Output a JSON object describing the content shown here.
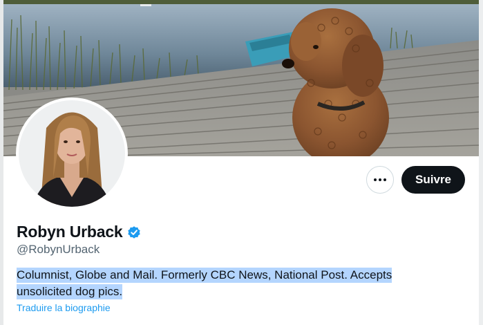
{
  "profile": {
    "display_name": "Robyn Urback",
    "handle": "@RobynUrback",
    "verified": true,
    "bio_line1": "Columnist, Globe and Mail. Formerly CBC News, National Post. Accepts",
    "bio_line2": "unsolicited dog pics.",
    "translate_link": "Traduire la biographie"
  },
  "actions": {
    "follow_label": "Suivre",
    "more_icon": "more-horizontal-icon"
  },
  "images": {
    "banner": "banner-dog-on-dock",
    "avatar": "avatar-portrait"
  },
  "colors": {
    "text_primary": "#0f1419",
    "text_secondary": "#536471",
    "link": "#1d9bf0",
    "verified": "#1d9bf0",
    "follow_button_bg": "#0f1419",
    "selection_highlight": "#b4d5fe"
  }
}
